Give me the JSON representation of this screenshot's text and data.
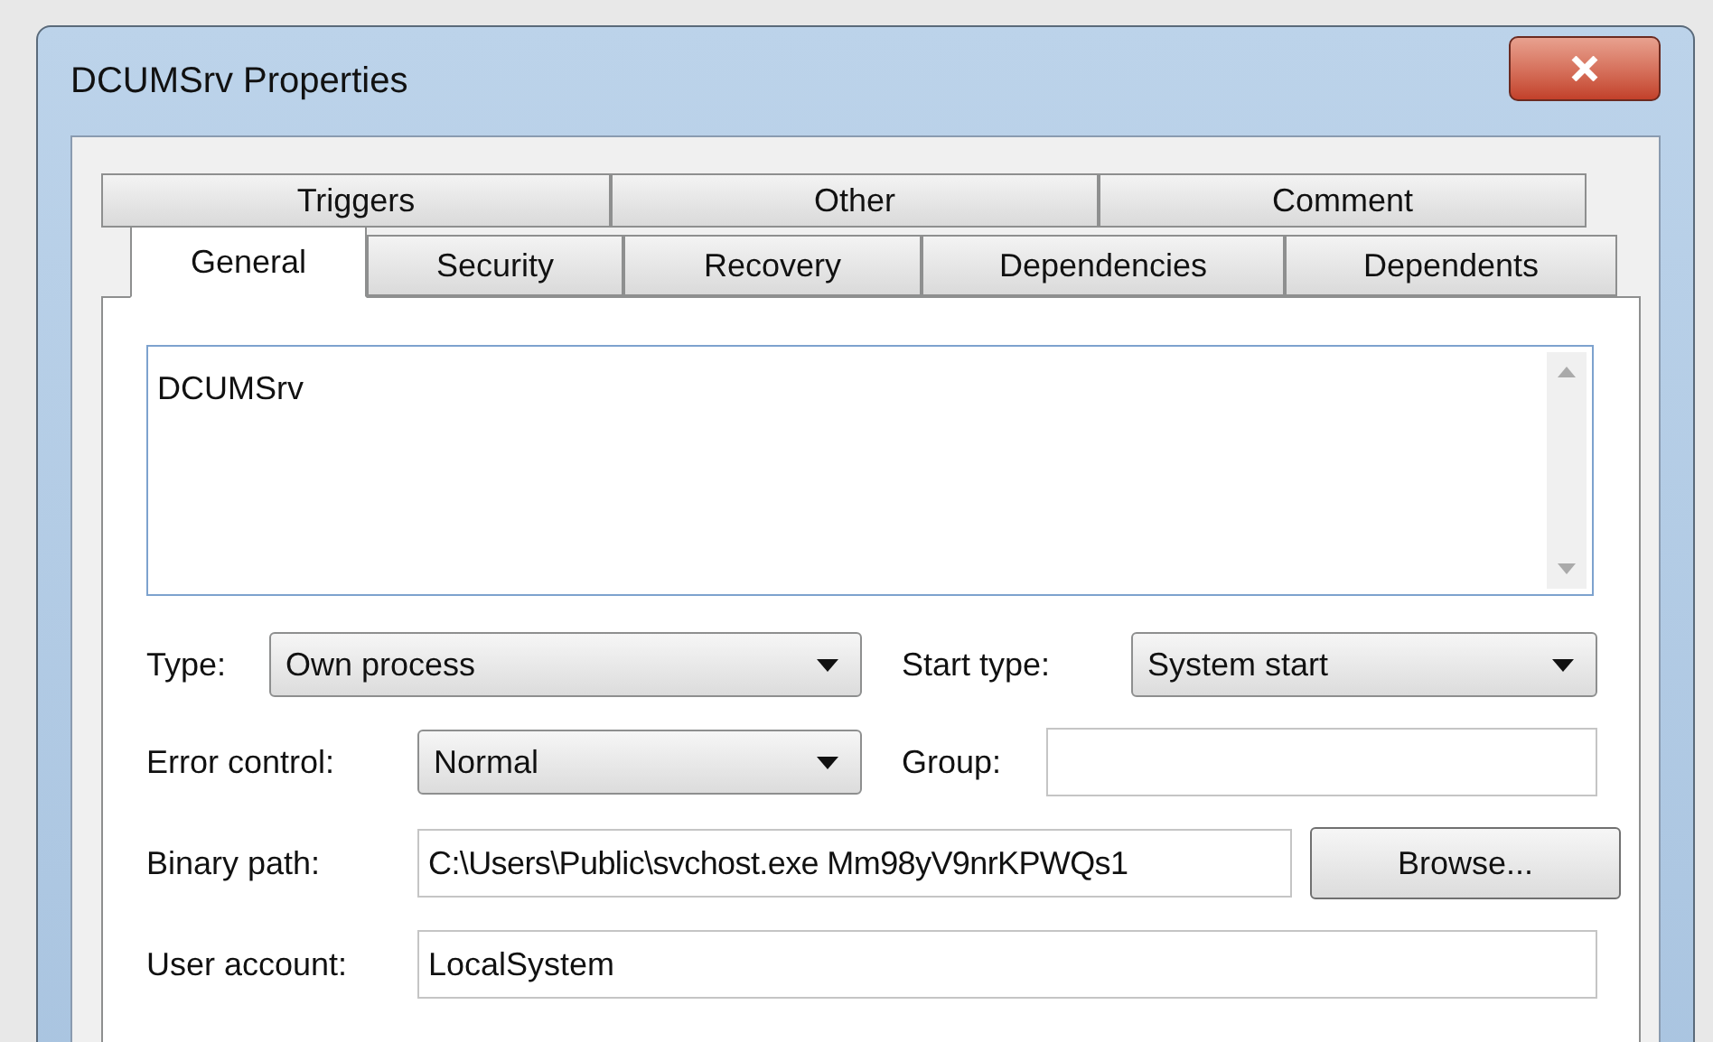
{
  "window": {
    "title": "DCUMSrv Properties"
  },
  "tabs_back": [
    {
      "label": "Triggers",
      "selected": false
    },
    {
      "label": "Other",
      "selected": false
    },
    {
      "label": "Comment",
      "selected": false
    }
  ],
  "tabs_front": [
    {
      "label": "General",
      "selected": true
    },
    {
      "label": "Security",
      "selected": false
    },
    {
      "label": "Recovery",
      "selected": false
    },
    {
      "label": "Dependencies",
      "selected": false
    },
    {
      "label": "Dependents",
      "selected": false
    }
  ],
  "description": {
    "value": "DCUMSrv"
  },
  "type": {
    "label": "Type:",
    "value": "Own process"
  },
  "start_type": {
    "label": "Start type:",
    "value": "System start"
  },
  "error_control": {
    "label": "Error control:",
    "value": "Normal"
  },
  "group": {
    "label": "Group:"
  },
  "binary_path": {
    "label": "Binary path:",
    "value": "C:\\Users\\Public\\svchost.exe Mm98yV9nrKPWQs1",
    "button": "Browse..."
  },
  "user_account": {
    "label": "User account:",
    "value": "LocalSystem"
  }
}
